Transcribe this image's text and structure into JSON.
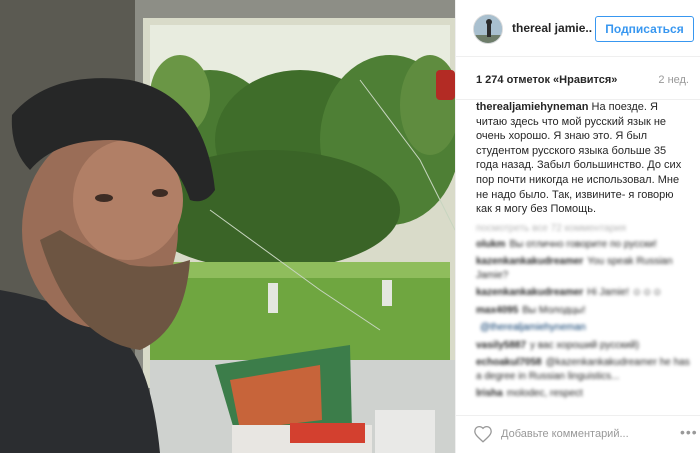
{
  "post": {
    "username": "thereal jamie..",
    "follow_label": "Подписаться",
    "likes": "1 274 отметок «Нравится»",
    "age": "2 нед.",
    "caption_author": "therealjamiehyneman",
    "caption_text": "На поезде. Я читаю здесь что мой русский язык не очень хорошо. Я знаю это. Я был студентом русского языка больше 35 года назад. Забыл большинство. До сих пор почти никогда не использовал. Мне не надо было. Так, извините- я говорю как я могу без Помощь.",
    "load_more": "посмотреть все 72 комментария"
  },
  "comments": [
    {
      "user": "olukm",
      "text": "Вы отлично говорите по русски!"
    },
    {
      "user": "kazenkankakudreamer",
      "text": "You speak Russian Jamie?"
    },
    {
      "user": "kazenkankakudreamer",
      "text": "Hi Jamie! ☺☺☺"
    },
    {
      "user": "max4095",
      "text": "Вы Молодцы!"
    },
    {
      "user": "",
      "text": "@therealjamiehyneman"
    },
    {
      "user": "vasily5887",
      "text": "у вас хороший русский)"
    },
    {
      "user": "echoakul7058",
      "text": "@kazenkankakudreamer he has a degree in Russian linguistics..."
    },
    {
      "user": "lrisha",
      "text": "molodec, respect"
    }
  ],
  "add_comment": {
    "placeholder": "Добавьте комментарий..."
  },
  "colors": {
    "accent": "#3897f0",
    "border": "#efefef",
    "muted": "#999999"
  },
  "icons": {
    "like": "heart-icon",
    "options": "more-dots-icon",
    "avatar": "profile-avatar"
  }
}
